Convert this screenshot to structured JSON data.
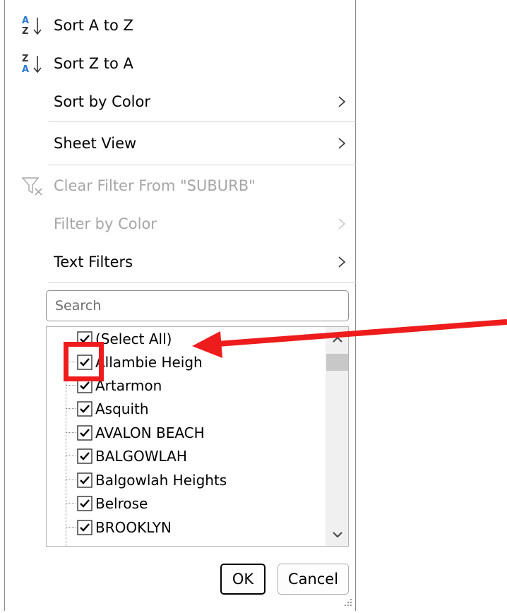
{
  "menu": {
    "sort_az": "Sort A to Z",
    "sort_za": "Sort Z to A",
    "sort_by_color": "Sort by Color",
    "sheet_view": "Sheet View",
    "clear_filter": "Clear Filter From \"SUBURB\"",
    "filter_by_color": "Filter by Color",
    "text_filters": "Text Filters"
  },
  "search": {
    "placeholder": "Search"
  },
  "list": {
    "items": [
      {
        "label": "(Select All)",
        "checked": true
      },
      {
        "label": "Allambie Heigh",
        "checked": true
      },
      {
        "label": "Artarmon",
        "checked": true
      },
      {
        "label": "Asquith",
        "checked": true
      },
      {
        "label": "AVALON BEACH",
        "checked": true
      },
      {
        "label": "BALGOWLAH",
        "checked": true
      },
      {
        "label": "Balgowlah Heights",
        "checked": true
      },
      {
        "label": "Belrose",
        "checked": true
      },
      {
        "label": "BROOKLYN",
        "checked": true
      }
    ]
  },
  "buttons": {
    "ok": "OK",
    "cancel": "Cancel"
  },
  "icons": {
    "sort_az": "sort-a-to-z-icon",
    "sort_za": "sort-z-to-a-icon",
    "clear_filter": "clear-filter-icon",
    "submenu": "chevron-right-icon"
  },
  "colors": {
    "sort_icon_blue": "#2b7bd5",
    "disabled_text": "#a6a6a6",
    "annotation_red": "#ee1c1c"
  }
}
